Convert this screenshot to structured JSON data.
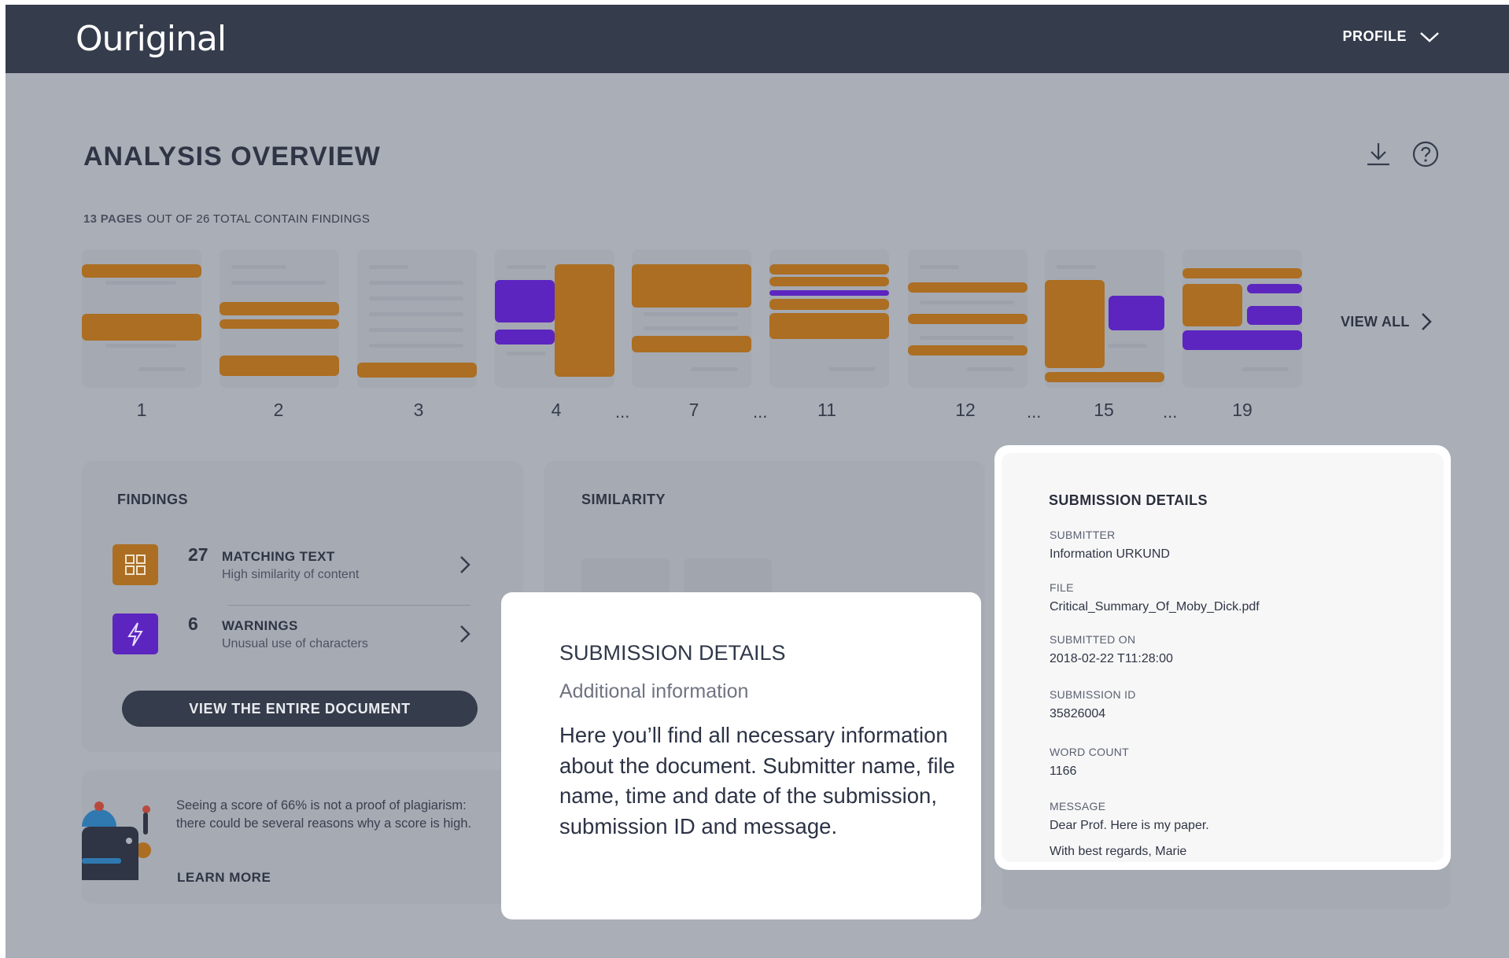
{
  "header": {
    "logo": "Ouriginal",
    "profile_label": "PROFILE"
  },
  "overview": {
    "title": "ANALYSIS OVERVIEW",
    "pages_highlight": "13 PAGES",
    "pages_rest": "OUT OF 26 TOTAL CONTAIN FINDINGS",
    "view_all_label": "VIEW ALL",
    "page_numbers": [
      "1",
      "2",
      "3",
      "4",
      "7",
      "11",
      "12",
      "15",
      "19"
    ],
    "ellipsis": "..."
  },
  "findings": {
    "title": "FINDINGS",
    "matching": {
      "count": "27",
      "label": "MATCHING TEXT",
      "sub": "High similarity of content",
      "icon": "grid-icon",
      "color": "#ab6e22"
    },
    "warnings": {
      "count": "6",
      "label": "WARNINGS",
      "sub": "Unusual use of characters",
      "icon": "lightning-icon",
      "color": "#5c25c0"
    },
    "view_button": "VIEW THE ENTIRE DOCUMENT"
  },
  "tip": {
    "text": "Seeing a score of 66% is not a proof of plagiarism: there could be several reasons why a score is high.",
    "link": "LEARN MORE"
  },
  "similarity": {
    "title": "SIMILARITY"
  },
  "submission": {
    "title": "SUBMISSION DETAILS",
    "submitter_label": "SUBMITTER",
    "submitter": "Information URKUND",
    "file_label": "FILE",
    "file": "Critical_Summary_Of_Moby_Dick.pdf",
    "submitted_on_label": "SUBMITTED ON",
    "submitted_on": "2018-02-22 T11:28:00",
    "submission_id_label": "SUBMISSION ID",
    "submission_id": "35826004",
    "word_count_label": "WORD COUNT",
    "word_count": "1166",
    "message_label": "MESSAGE",
    "message_line1": "Dear Prof. Here is my paper.",
    "message_line2": "With best regards, Marie"
  },
  "tooltip": {
    "title": "SUBMISSION DETAILS",
    "subtitle": "Additional information",
    "body": "Here you’ll find all necessary information about the document. Submitter name, file name, time and date of the submission, submission ID and message."
  },
  "colors": {
    "header": "#353c4c",
    "overlay": "#aaaeb7",
    "matching": "#ab6e22",
    "warning": "#5c25c0"
  }
}
